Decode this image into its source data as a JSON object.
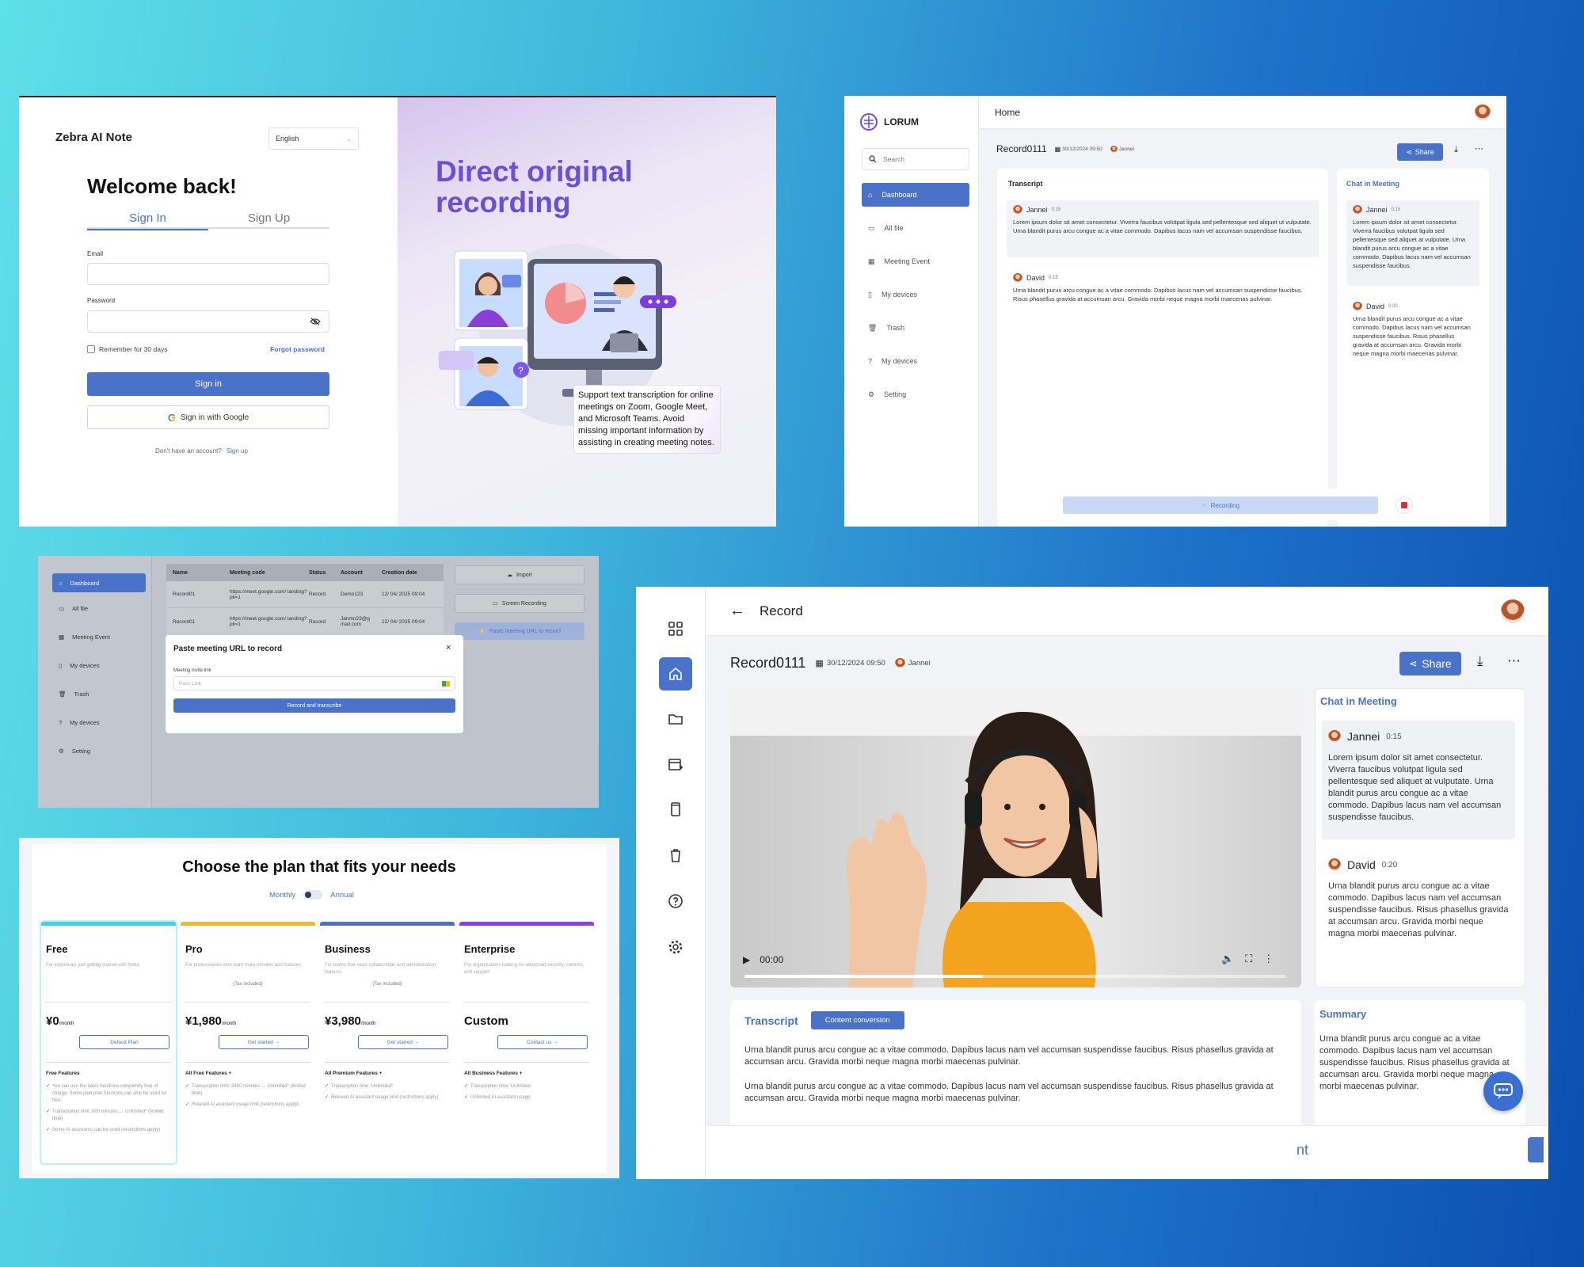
{
  "login": {
    "brand": "Zebra AI Note",
    "language": "English",
    "welcome": "Welcome back!",
    "tabs": [
      "Sign In",
      "Sign Up"
    ],
    "email_label": "Email",
    "password_label": "Password",
    "remember": "Remember for 30 days",
    "forgot": "Forgot password",
    "sign_in": "Sign in",
    "google": "Sign in with Google",
    "no_account": "Don't have an account?",
    "sign_up_link": "Sign up",
    "hero_title": "Direct original recording",
    "hero_caption": "Support text transcription for online meetings on Zoom, Google Meet, and Microsoft Teams.  Avoid missing important information by assisting in creating meeting notes."
  },
  "dash": {
    "logo": "LORUM",
    "page_title": "Home",
    "search_placeholder": "Search",
    "sidebar": [
      "Dashboard",
      "All file",
      "Meeting Event",
      "My devices",
      "Trash",
      "My devices",
      "Setting"
    ],
    "record_title": "Record0111",
    "record_date": "30/12/2024 09:50",
    "record_user": "Jannei",
    "share": "Share",
    "transcript_title": "Transcript",
    "chat_title": "Chat in Meeting",
    "messages": [
      {
        "name": "Jannei",
        "time": "0:15",
        "text": "Lorem ipsum dolor sit amet consectetur. Viverra faucibus volutpat ligula sed pellentesque sed aliquet ut vulputate. Urna blandit purus arcu congue ac a vitae commodo. Dapibus lacus nam vel accumsan suspendisse faucibus."
      },
      {
        "name": "David",
        "time": "0:15",
        "text": "Urna blandit purus arcu congue ac a vitae commodo. Dapibus lacus nam vel accumsan suspendisse faucibus. Risus phasellus gravida at accumsan arcu. Gravida morbi neque magna morbi maecenas pulvinar."
      }
    ],
    "chat": [
      {
        "name": "Jannei",
        "time": "0:15",
        "text": "Lorem ipsum dolor sit amet consectetur. Viverra faucibus volutpat ligula sed pellentesque sed aliquet at vulputate. Urna blandit purus arcu congue ac a vitae commodo. Dapibus lacus nam vel accumsan suspendisse faucibus."
      },
      {
        "name": "David",
        "time": "0:20",
        "text": "Urna blandit purus arcu congue ac a vitae commodo. Dapibus lacus nam vel accumsan suspendisse faucibus. Risus phasellus gravida at accumsan arcu. Gravida morbi neque magna morbi maecenas pulvinar."
      }
    ],
    "recording": "Recording"
  },
  "paste": {
    "sidebar": [
      "Dashboard",
      "All file",
      "Meeting Event",
      "My devices",
      "Trash",
      "My devices",
      "Setting"
    ],
    "columns": [
      "Name",
      "Meeting code",
      "Status",
      "Account",
      "Creation date"
    ],
    "rows": [
      [
        "Record01",
        "https://meet.google.com/ landing?pli=1",
        "Record",
        "Demo123",
        "12/ 04/ 2025 09:04"
      ],
      [
        "Record01",
        "https://meet.google.com/ landing?pli=1",
        "Record",
        "Janmn23@g mail.com",
        "12/ 04/ 2025 09:04"
      ]
    ],
    "actions": [
      "Import",
      "Screen Recording",
      "Paste meeting URL to record"
    ],
    "modal_title": "Paste meeting URL to record",
    "modal_label": "Meeting invite link",
    "modal_placeholder": "Pass Link",
    "modal_button": "Record and transcribe"
  },
  "pricing": {
    "title": "Choose the plan that fits your needs",
    "monthly": "Monthly",
    "annual": "Annual",
    "plans": [
      {
        "name": "Free",
        "desc": "For individuals just getting started with Notta",
        "tax": "",
        "price": "¥0",
        "per": "/month",
        "button": "Default Plan",
        "feat_head": "Free Features",
        "features": [
          "You can use the basic functions completely free of charge. Some paid plan functions can also be used for free.",
          "Transcription limit: 600 minutes → Unlimited* (limited time)",
          "Some AI assistants can be used (restrictions apply)"
        ],
        "color": "#3fd0ea"
      },
      {
        "name": "Pro",
        "desc": "For professionals who want more minutes and features",
        "tax": "(Tax included)",
        "price": "¥1,980",
        "per": "/month",
        "button": "Get started →",
        "feat_head": "All Free Features +",
        "features": [
          "Transcription limit: 2400 minutes → Unlimited* (limited time)",
          "Relaxed AI assistant usage limit (restrictions apply)"
        ],
        "color": "#f5b731"
      },
      {
        "name": "Business",
        "desc": "For teams that need collaboration and administration features",
        "tax": "(Tax included)",
        "price": "¥3,980",
        "per": "/month",
        "button": "Get started →",
        "feat_head": "All Premium Features +",
        "features": [
          "Transcription time: Unlimited*",
          "Relaxed AI assistant usage limit (restrictions apply)"
        ],
        "color": "#4a72c9"
      },
      {
        "name": "Enterprise",
        "desc": "For organizations looking for advanced security, controls, and support",
        "tax": "",
        "price": "Custom",
        "per": "",
        "button": "Contact us →",
        "feat_head": "All Business Features +",
        "features": [
          "Transcription time: Unlimited",
          "Unlimited AI assistant usage"
        ],
        "color": "#8b3fe0"
      }
    ]
  },
  "record": {
    "title": "Record",
    "record_title": "Record0111",
    "date": "30/12/2024 09:50",
    "user": "Jannei",
    "share": "Share",
    "video_time": "00:00",
    "video_progress": 0.44,
    "chat_title": "Chat in Meeting",
    "chat": [
      {
        "name": "Jannei",
        "time": "0:15",
        "text": "Lorem ipsum dolor sit amet consectetur. Viverra faucibus volutpat ligula sed pellentesque sed aliquet at vulputate. Urna blandit purus arcu congue ac a vitae commodo. Dapibus lacus nam vel accumsan suspendisse faucibus."
      },
      {
        "name": "David",
        "time": "0:20",
        "text": "Urna blandit purus arcu congue ac a vitae commodo. Dapibus lacus nam vel accumsan suspendisse faucibus. Risus phasellus gravida at accumsan arcu. Gravida morbi neque magna morbi maecenas pulvinar."
      }
    ],
    "transcript_tab": "Transcript",
    "content_tab": "Content conversion",
    "transcript": [
      "Urna blandit purus arcu congue ac a vitae commodo. Dapibus lacus nam vel accumsan suspendisse faucibus. Risus phasellus gravida at accumsan arcu. Gravida morbi neque magna morbi maecenas pulvinar.",
      "Urna blandit purus arcu congue ac a vitae commodo. Dapibus lacus nam vel accumsan suspendisse faucibus. Risus phasellus gravida at accumsan arcu. Gravida morbi neque magna morbi maecenas pulvinar."
    ],
    "summary_title": "Summary",
    "summary": "Urna blandit purus arcu congue ac a vitae commodo. Dapibus lacus nam vel accumsan suspendisse faucibus. Risus phasellus gravida at accumsan arcu. Gravida morbi neque magna morbi maecenas pulvinar.",
    "footer_fragment": "nt"
  },
  "colors": {
    "accent": "#4a72c9",
    "hero_purple": "#6b4fd6",
    "recording_bar": "#c9d8f6"
  }
}
